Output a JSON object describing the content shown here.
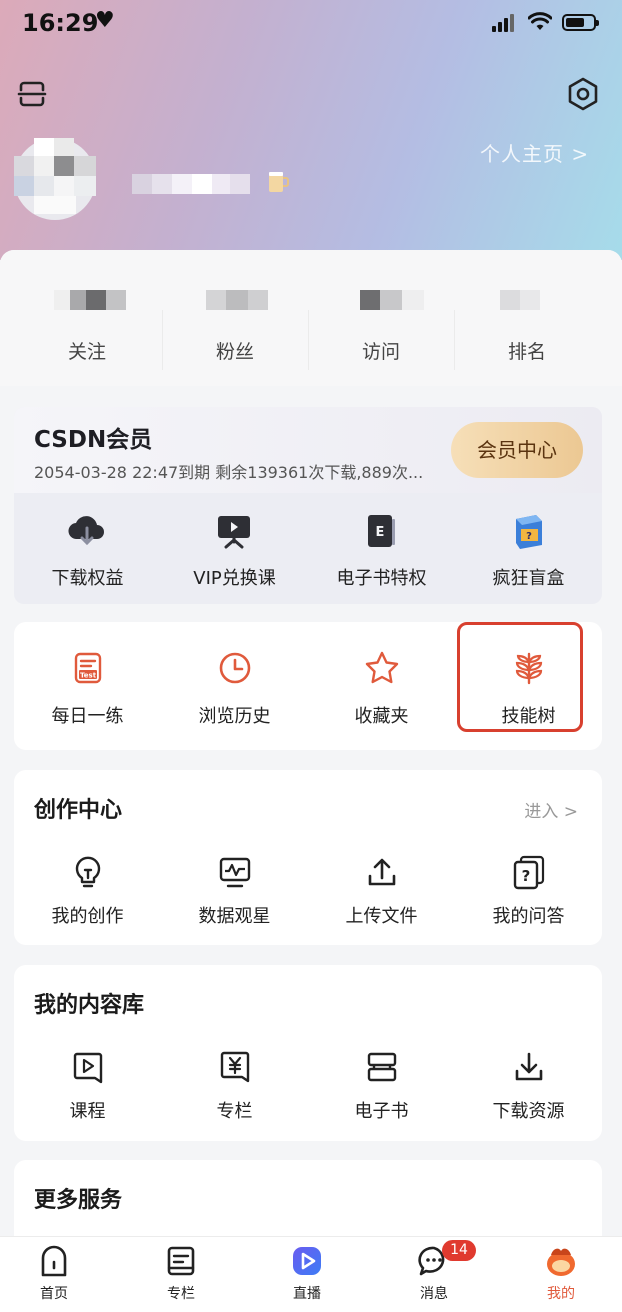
{
  "status_bar": {
    "time": "16:29"
  },
  "header": {
    "profile_link": "个人主页 >"
  },
  "stats": [
    {
      "label": "关注"
    },
    {
      "label": "粉丝"
    },
    {
      "label": "访问"
    },
    {
      "label": "排名"
    }
  ],
  "vip": {
    "title": "CSDN会员",
    "description": "2054-03-28 22:47到期 剩余139361次下载,889次...",
    "center_button": "会员中心",
    "items": [
      {
        "label": "下载权益",
        "icon": "cloud-download-icon"
      },
      {
        "label": "VIP兑换课",
        "icon": "video-board-icon"
      },
      {
        "label": "电子书特权",
        "icon": "ebook-icon"
      },
      {
        "label": "疯狂盲盒",
        "icon": "blind-box-icon"
      }
    ]
  },
  "quick_tools": [
    {
      "label": "每日一练",
      "icon": "daily-test-icon"
    },
    {
      "label": "浏览历史",
      "icon": "clock-icon"
    },
    {
      "label": "收藏夹",
      "icon": "star-icon"
    },
    {
      "label": "技能树",
      "icon": "skill-tree-icon"
    }
  ],
  "creation": {
    "title": "创作中心",
    "enter": "进入 >",
    "items": [
      {
        "label": "我的创作",
        "icon": "lightbulb-icon"
      },
      {
        "label": "数据观星",
        "icon": "monitor-chart-icon"
      },
      {
        "label": "上传文件",
        "icon": "upload-icon"
      },
      {
        "label": "我的问答",
        "icon": "question-icon"
      }
    ]
  },
  "library": {
    "title": "我的内容库",
    "items": [
      {
        "label": "课程",
        "icon": "play-course-icon"
      },
      {
        "label": "专栏",
        "icon": "yen-column-icon"
      },
      {
        "label": "电子书",
        "icon": "book-stack-icon"
      },
      {
        "label": "下载资源",
        "icon": "download-icon"
      }
    ]
  },
  "more": {
    "title": "更多服务"
  },
  "tabbar": {
    "tabs": [
      {
        "label": "首页",
        "icon": "home-icon"
      },
      {
        "label": "专栏",
        "icon": "column-icon"
      },
      {
        "label": "直播",
        "icon": "live-icon"
      },
      {
        "label": "消息",
        "icon": "message-icon"
      },
      {
        "label": "我的",
        "icon": "me-icon"
      }
    ],
    "message_badge": "14"
  },
  "colors": {
    "accent": "#e05a3c",
    "highlight_border": "#d8402f",
    "badge": "#e03a2f",
    "vip_gold": "#ecc893"
  }
}
